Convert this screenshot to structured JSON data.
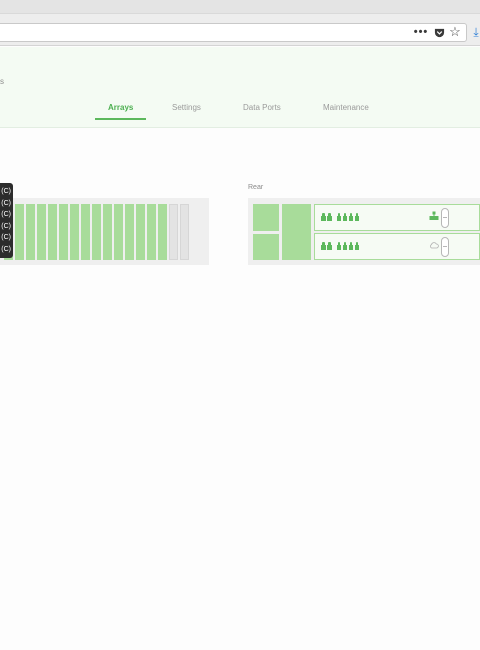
{
  "browser": {
    "toolbar_icons": [
      "more-dots-icon",
      "pocket-icon",
      "bookmark-star-icon",
      "download-arrow-icon"
    ],
    "dots_glyph": "•••",
    "star_glyph": "☆",
    "download_glyph": "⤓"
  },
  "header": {
    "fragment_text": "s"
  },
  "tabs": [
    {
      "label": "Arrays",
      "active": true
    },
    {
      "label": "Settings",
      "active": false
    },
    {
      "label": "Data Ports",
      "active": false
    },
    {
      "label": "Maintenance",
      "active": false
    }
  ],
  "tooltip": {
    "lines": [
      "(C)",
      "(C)",
      "(C)",
      "(C)",
      "(C)",
      "(C)"
    ]
  },
  "front_panel": {
    "occupied_bays": 15,
    "empty_bays": 2,
    "occupied_color": "#a8dc9a",
    "empty_color": "#e3e3e3"
  },
  "rear_panel": {
    "label": "Rear",
    "controllers": [
      {
        "ports": 6,
        "status_icon": "network-status-icon",
        "status_active": true
      },
      {
        "ports": 6,
        "status_icon": "cloud-status-icon",
        "status_active": false
      }
    ]
  },
  "colors": {
    "accent": "#4caf50",
    "header_bg": "#f4fbf3",
    "drive_green": "#a8dc9a",
    "panel_bg": "#efefef"
  }
}
